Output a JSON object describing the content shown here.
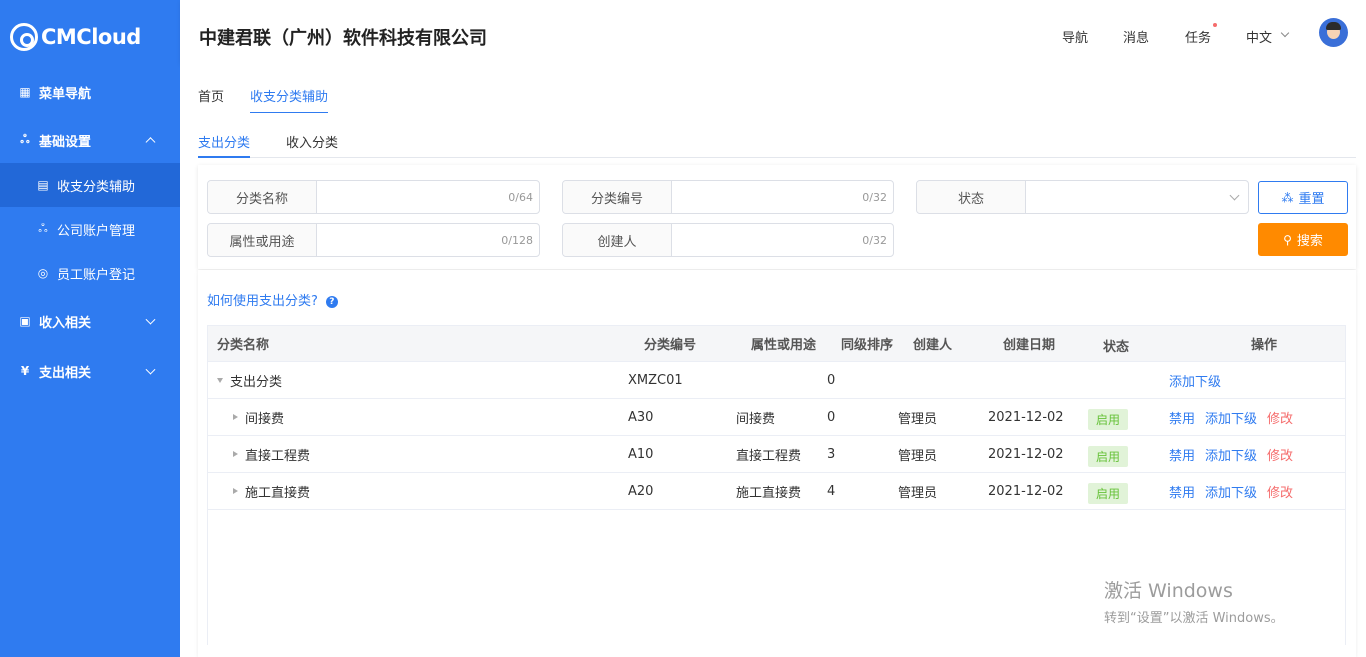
{
  "app": {
    "logo_text": "CMCloud"
  },
  "sidebar": {
    "items": [
      {
        "label": "菜单导航"
      },
      {
        "label": "基础设置"
      },
      {
        "label": "收支分类辅助"
      },
      {
        "label": "公司账户管理"
      },
      {
        "label": "员工账户登记"
      },
      {
        "label": "收入相关"
      },
      {
        "label": "支出相关"
      }
    ]
  },
  "header": {
    "company": "中建君联（广州）软件科技有限公司",
    "nav": "导航",
    "messages": "消息",
    "tasks": "任务",
    "language": "中文"
  },
  "breadcrumb": [
    "首页",
    "收支分类辅助"
  ],
  "subtabs": [
    "支出分类",
    "收入分类"
  ],
  "filters": {
    "name": {
      "label": "分类名称",
      "count": "0/64"
    },
    "code": {
      "label": "分类编号",
      "count": "0/32"
    },
    "status": {
      "label": "状态"
    },
    "purpose": {
      "label": "属性或用途",
      "count": "0/128"
    },
    "creator": {
      "label": "创建人",
      "count": "0/32"
    },
    "reset": "重置",
    "search": "搜索"
  },
  "help": "如何使用支出分类?",
  "table": {
    "columns": [
      "分类名称",
      "分类编号",
      "属性或用途",
      "同级排序",
      "创建人",
      "创建日期",
      "状态",
      "操作"
    ],
    "rows": [
      {
        "name": "支出分类",
        "code": "XMZC01",
        "purpose": "",
        "sort": "0",
        "creator": "",
        "date": "",
        "status": "",
        "actions": [
          "添加下级"
        ]
      },
      {
        "name": "间接费",
        "code": "A30",
        "purpose": "间接费",
        "sort": "0",
        "creator": "管理员",
        "date": "2021-12-02",
        "status": "启用",
        "actions": [
          "禁用",
          "添加下级",
          "修改"
        ]
      },
      {
        "name": "直接工程费",
        "code": "A10",
        "purpose": "直接工程费",
        "sort": "3",
        "creator": "管理员",
        "date": "2021-12-02",
        "status": "启用",
        "actions": [
          "禁用",
          "添加下级",
          "修改"
        ]
      },
      {
        "name": "施工直接费",
        "code": "A20",
        "purpose": "施工直接费",
        "sort": "4",
        "creator": "管理员",
        "date": "2021-12-02",
        "status": "启用",
        "actions": [
          "禁用",
          "添加下级",
          "修改"
        ]
      }
    ]
  },
  "watermark": {
    "line1": "激活 Windows",
    "line2": "转到“设置”以激活 Windows。"
  },
  "colors": {
    "sidebar": "#2f7bf0",
    "accent": "#2f7bf0",
    "search_button": "#ff8a00",
    "status_tag_bg": "#e1f3d8",
    "status_tag_text": "#67c23a",
    "danger": "#f56c6c"
  }
}
